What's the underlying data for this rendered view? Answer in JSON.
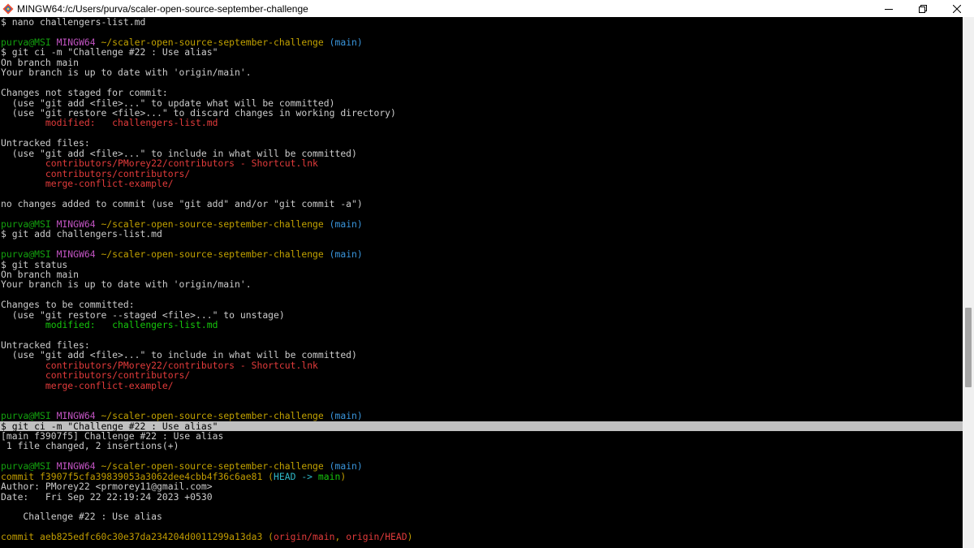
{
  "window": {
    "title": "MINGW64:/c/Users/purva/scaler-open-source-september-challenge",
    "app_icon": "git-bash-icon",
    "controls": [
      "minimize-icon",
      "restore-icon",
      "close-icon"
    ]
  },
  "terminal": {
    "lines": [
      {
        "segs": [
          {
            "t": "$ nano challengers-list.md",
            "c": "white"
          }
        ]
      },
      {
        "segs": [
          {
            "t": "",
            "c": "white"
          }
        ]
      },
      {
        "segs": [
          {
            "t": "purva@MSI ",
            "c": "green"
          },
          {
            "t": "MINGW64 ",
            "c": "magenta"
          },
          {
            "t": "~/scaler-open-source-september-challenge",
            "c": "yellow"
          },
          {
            "t": " (main)",
            "c": "cyan"
          }
        ]
      },
      {
        "segs": [
          {
            "t": "$ git ci -m \"Challenge #22 : Use alias\"",
            "c": "white"
          }
        ]
      },
      {
        "segs": [
          {
            "t": "On branch main",
            "c": "white"
          }
        ]
      },
      {
        "segs": [
          {
            "t": "Your branch is up to date with 'origin/main'.",
            "c": "white"
          }
        ]
      },
      {
        "segs": [
          {
            "t": "",
            "c": "white"
          }
        ]
      },
      {
        "segs": [
          {
            "t": "Changes not staged for commit:",
            "c": "white"
          }
        ]
      },
      {
        "segs": [
          {
            "t": "  (use \"git add <file>...\" to update what will be committed)",
            "c": "white"
          }
        ]
      },
      {
        "segs": [
          {
            "t": "  (use \"git restore <file>...\" to discard changes in working directory)",
            "c": "white"
          }
        ]
      },
      {
        "segs": [
          {
            "t": "        ",
            "c": "white"
          },
          {
            "t": "modified:   challengers-list.md",
            "c": "red"
          }
        ]
      },
      {
        "segs": [
          {
            "t": "",
            "c": "white"
          }
        ]
      },
      {
        "segs": [
          {
            "t": "Untracked files:",
            "c": "white"
          }
        ]
      },
      {
        "segs": [
          {
            "t": "  (use \"git add <file>...\" to include in what will be committed)",
            "c": "white"
          }
        ]
      },
      {
        "segs": [
          {
            "t": "        ",
            "c": "white"
          },
          {
            "t": "contributors/PMorey22/contributors - Shortcut.lnk",
            "c": "red"
          }
        ]
      },
      {
        "segs": [
          {
            "t": "        ",
            "c": "white"
          },
          {
            "t": "contributors/contributors/",
            "c": "red"
          }
        ]
      },
      {
        "segs": [
          {
            "t": "        ",
            "c": "white"
          },
          {
            "t": "merge-conflict-example/",
            "c": "red"
          }
        ]
      },
      {
        "segs": [
          {
            "t": "",
            "c": "white"
          }
        ]
      },
      {
        "segs": [
          {
            "t": "no changes added to commit (use \"git add\" and/or \"git commit -a\")",
            "c": "white"
          }
        ]
      },
      {
        "segs": [
          {
            "t": "",
            "c": "white"
          }
        ]
      },
      {
        "segs": [
          {
            "t": "purva@MSI ",
            "c": "green"
          },
          {
            "t": "MINGW64 ",
            "c": "magenta"
          },
          {
            "t": "~/scaler-open-source-september-challenge",
            "c": "yellow"
          },
          {
            "t": " (main)",
            "c": "cyan"
          }
        ]
      },
      {
        "segs": [
          {
            "t": "$ git add challengers-list.md",
            "c": "white"
          }
        ]
      },
      {
        "segs": [
          {
            "t": "",
            "c": "white"
          }
        ]
      },
      {
        "segs": [
          {
            "t": "purva@MSI ",
            "c": "green"
          },
          {
            "t": "MINGW64 ",
            "c": "magenta"
          },
          {
            "t": "~/scaler-open-source-september-challenge",
            "c": "yellow"
          },
          {
            "t": " (main)",
            "c": "cyan"
          }
        ]
      },
      {
        "segs": [
          {
            "t": "$ git status",
            "c": "white"
          }
        ]
      },
      {
        "segs": [
          {
            "t": "On branch main",
            "c": "white"
          }
        ]
      },
      {
        "segs": [
          {
            "t": "Your branch is up to date with 'origin/main'.",
            "c": "white"
          }
        ]
      },
      {
        "segs": [
          {
            "t": "",
            "c": "white"
          }
        ]
      },
      {
        "segs": [
          {
            "t": "Changes to be committed:",
            "c": "white"
          }
        ]
      },
      {
        "segs": [
          {
            "t": "  (use \"git restore --staged <file>...\" to unstage)",
            "c": "white"
          }
        ]
      },
      {
        "segs": [
          {
            "t": "        ",
            "c": "white"
          },
          {
            "t": "modified:   challengers-list.md",
            "c": "green-b"
          }
        ]
      },
      {
        "segs": [
          {
            "t": "",
            "c": "white"
          }
        ]
      },
      {
        "segs": [
          {
            "t": "Untracked files:",
            "c": "white"
          }
        ]
      },
      {
        "segs": [
          {
            "t": "  (use \"git add <file>...\" to include in what will be committed)",
            "c": "white"
          }
        ]
      },
      {
        "segs": [
          {
            "t": "        ",
            "c": "white"
          },
          {
            "t": "contributors/PMorey22/contributors - Shortcut.lnk",
            "c": "red"
          }
        ]
      },
      {
        "segs": [
          {
            "t": "        ",
            "c": "white"
          },
          {
            "t": "contributors/contributors/",
            "c": "red"
          }
        ]
      },
      {
        "segs": [
          {
            "t": "        ",
            "c": "white"
          },
          {
            "t": "merge-conflict-example/",
            "c": "red"
          }
        ]
      },
      {
        "segs": [
          {
            "t": "",
            "c": "white"
          }
        ]
      },
      {
        "segs": [
          {
            "t": "",
            "c": "white"
          }
        ]
      },
      {
        "segs": [
          {
            "t": "purva@MSI ",
            "c": "green"
          },
          {
            "t": "MINGW64 ",
            "c": "magenta"
          },
          {
            "t": "~/scaler-open-source-september-challenge",
            "c": "yellow"
          },
          {
            "t": " (main)",
            "c": "cyan"
          }
        ]
      },
      {
        "hl": true,
        "segs": [
          {
            "t": "$ git ci -m \"Challenge #22 : Use alias\"",
            "c": ""
          }
        ]
      },
      {
        "segs": [
          {
            "t": "[main f3907f5] Challenge #22 : Use alias",
            "c": "white"
          }
        ]
      },
      {
        "segs": [
          {
            "t": " 1 file changed, 2 insertions(+)",
            "c": "white"
          }
        ]
      },
      {
        "segs": [
          {
            "t": "",
            "c": "white"
          }
        ]
      },
      {
        "segs": [
          {
            "t": "purva@MSI ",
            "c": "green"
          },
          {
            "t": "MINGW64 ",
            "c": "magenta"
          },
          {
            "t": "~/scaler-open-source-september-challenge",
            "c": "yellow"
          },
          {
            "t": " (main)",
            "c": "cyan"
          }
        ]
      },
      {
        "segs": [
          {
            "t": "commit f3907f5cfa39839053a3062dee4cbb4f36c6ae81 ",
            "c": "gold"
          },
          {
            "t": "(",
            "c": "gold"
          },
          {
            "t": "HEAD -> ",
            "c": "cyan-b"
          },
          {
            "t": "main",
            "c": "green-b"
          },
          {
            "t": ")",
            "c": "gold"
          }
        ]
      },
      {
        "segs": [
          {
            "t": "Author: PMorey22 <prmorey11@gmail.com>",
            "c": "white"
          }
        ]
      },
      {
        "segs": [
          {
            "t": "Date:   Fri Sep 22 22:19:24 2023 +0530",
            "c": "white"
          }
        ]
      },
      {
        "segs": [
          {
            "t": "",
            "c": "white"
          }
        ]
      },
      {
        "segs": [
          {
            "t": "    Challenge #22 : Use alias",
            "c": "white"
          }
        ]
      },
      {
        "segs": [
          {
            "t": "",
            "c": "white"
          }
        ]
      },
      {
        "segs": [
          {
            "t": "commit aeb825edfc60c30e37da234204d0011299a13da3 ",
            "c": "gold"
          },
          {
            "t": "(",
            "c": "gold"
          },
          {
            "t": "origin/main",
            "c": "red"
          },
          {
            "t": ", ",
            "c": "gold"
          },
          {
            "t": "origin/HEAD",
            "c": "red"
          },
          {
            "t": ")",
            "c": "gold"
          }
        ]
      }
    ]
  },
  "colors": {
    "background": "#000000",
    "user_host": "#13a10e",
    "mingw": "#c254c2",
    "path": "#c1a100",
    "branch": "#3a96dd",
    "unstaged": "#e23b3b",
    "staged": "#16c60c",
    "commit_hash": "#c19c00"
  }
}
